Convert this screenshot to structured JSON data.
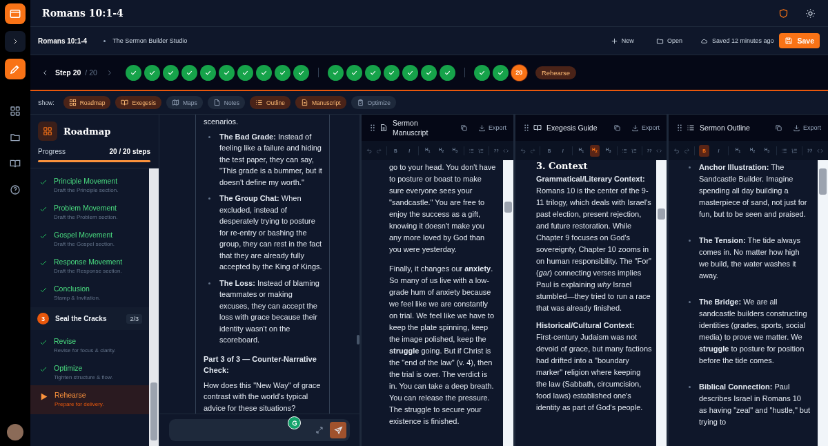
{
  "app": {
    "title": "Romans 10:1-4"
  },
  "header": {
    "title": "Romans 10:1-4",
    "subtitle": "The Sermon Builder Studio",
    "actions": [
      {
        "label": "New"
      },
      {
        "label": "Open"
      }
    ],
    "saved_status": "Saved 12 minutes ago",
    "save_button": "Save"
  },
  "stepper": {
    "label": "Step 20",
    "total": "/ 20",
    "current_name": "Rehearse",
    "groups": [
      {
        "steps": [
          {
            "completed": true
          },
          {
            "completed": true
          },
          {
            "completed": true
          },
          {
            "completed": true
          },
          {
            "completed": true
          },
          {
            "completed": true
          },
          {
            "completed": true
          },
          {
            "completed": true
          },
          {
            "completed": true
          },
          {
            "completed": true
          }
        ]
      },
      {
        "steps": [
          {
            "completed": true
          },
          {
            "completed": true
          },
          {
            "completed": true
          },
          {
            "completed": true
          },
          {
            "completed": true
          },
          {
            "completed": true
          },
          {
            "completed": true
          }
        ]
      },
      {
        "steps": [
          {
            "completed": true
          },
          {
            "completed": true
          },
          {
            "completed": false,
            "label": "20"
          }
        ]
      }
    ]
  },
  "show_bar": {
    "label": "Show:",
    "chips": [
      {
        "label": "Roadmap",
        "selected": true
      },
      {
        "label": "Exegesis",
        "selected": true
      },
      {
        "label": "Maps",
        "selected": false
      },
      {
        "label": "Notes",
        "selected": false
      },
      {
        "label": "Outline",
        "selected": true
      },
      {
        "label": "Manuscript",
        "selected": true
      },
      {
        "label": "Optimize",
        "selected": false
      }
    ]
  },
  "roadmap": {
    "title": "Roadmap",
    "progress_label": "Progress",
    "progress_value": "20 / 20 steps",
    "level": 1,
    "items": [
      {
        "kind": "step",
        "title": "Principle Movement",
        "subtitle": "Draft the Principle section.",
        "completed": true
      },
      {
        "kind": "step",
        "title": "Problem Movement",
        "subtitle": "Draft the Problem section.",
        "completed": true
      },
      {
        "kind": "step",
        "title": "Gospel Movement",
        "subtitle": "Draft the Gospel section.",
        "completed": true
      },
      {
        "kind": "step",
        "title": "Response Movement",
        "subtitle": "Draft the Response section.",
        "completed": true
      },
      {
        "kind": "step",
        "title": "Conclusion",
        "subtitle": "Stamp & Invitation.",
        "completed": true
      },
      {
        "kind": "group",
        "number": "3",
        "title": "Seal the Cracks",
        "count": "2/3"
      },
      {
        "kind": "step",
        "title": "Revise",
        "subtitle": "Revise for focus & clarity.",
        "completed": true
      },
      {
        "kind": "step",
        "title": "Optimize",
        "subtitle": "Tighten structure & flow.",
        "completed": true
      },
      {
        "kind": "step",
        "title": "Rehearse",
        "subtitle": "Prepare for delivery.",
        "completed": false
      }
    ]
  },
  "chat": {
    "blocks": [
      {
        "kind": "p",
        "text": "scenarios."
      },
      {
        "kind": "bullet",
        "text": "**The Bad Grade:** Instead of feeling like a failure and hiding the test paper, they can say, \"This grade is a bummer, but it doesn't define my worth.\""
      },
      {
        "kind": "bullet",
        "text": "**The Group Chat:** When excluded, instead of desperately trying to posture for re-entry or bashing the group, they can rest in the fact that they are already fully accepted by the King of Kings."
      },
      {
        "kind": "bullet",
        "text": "**The Loss:** Instead of blaming teammates or making excuses, they can accept the loss with grace because their identity wasn't on the scoreboard."
      },
      {
        "kind": "heading",
        "text": "Part 3 of 3 — Counter-Narrative Check:"
      },
      {
        "kind": "p",
        "text": "How does this \"New Way\" of grace contrast with the world's typical advice for these situations?"
      }
    ]
  },
  "panels": [
    {
      "title": "Sermon Manuscript",
      "export": "Export",
      "toolbar": [
        {
          "label": "B",
          "selected": false
        },
        {
          "label": "I",
          "selected": false
        },
        {
          "label": "H$_{1}$",
          "selected": false
        },
        {
          "label": "H$_{2}$",
          "selected": false
        },
        {
          "label": "H$_{3}$",
          "selected": false
        }
      ],
      "blocks": [
        {
          "kind": "p",
          "text": "go to your head. You don't have to posture or boast to make sure everyone sees your \"sandcastle.\" You are free to enjoy the success as a gift, knowing it doesn't make you any more loved by God than you were yesterday."
        },
        {
          "kind": "p",
          "text": "Finally, it changes our **anxiety**. So many of us live with a low-grade hum of anxiety because we feel like we are constantly on trial. We feel like we have to keep the plate spinning, keep the image polished, keep the **struggle** going. But if Christ is the \"end of the law\" (v. 4), then the trial is over. The verdict is in. You can take a deep breath. You can release the pressure. The struggle to secure your existence is finished."
        }
      ]
    },
    {
      "title": "Exegesis Guide",
      "export": "Export",
      "toolbar": [
        {
          "label": "B",
          "selected": false
        },
        {
          "label": "I",
          "selected": false
        },
        {
          "label": "H$_{1}$",
          "selected": false
        },
        {
          "label": "H$_{2}$",
          "selected": true
        },
        {
          "label": "H$_{3}$",
          "selected": false
        }
      ],
      "blocks": [
        {
          "kind": "heading",
          "text": "3. Context"
        },
        {
          "kind": "p",
          "text": "**Grammatical/Literary Context:** Romans 10 is the center of the 9-11 trilogy, which deals with Israel's past election, present rejection, and future restoration. While Chapter 9 focuses on God's sovereignty, Chapter 10 zooms in on human responsibility. The \"For\" (*gar*) connecting verses implies Paul is explaining *why* Israel stumbled—they tried to run a race that was already finished."
        },
        {
          "kind": "p",
          "text": "**Historical/Cultural Context:** First-century Judaism was not devoid of grace, but many factions had drifted into a \"boundary marker\" religion where keeping the law (Sabbath, circumcision, food laws) established one's identity as part of God's people."
        }
      ]
    },
    {
      "title": "Sermon Outline",
      "export": "Export",
      "toolbar": [
        {
          "label": "B",
          "selected": true
        },
        {
          "label": "I",
          "selected": false
        },
        {
          "label": "H$_{1}$",
          "selected": false
        },
        {
          "label": "H$_{2}$",
          "selected": false
        },
        {
          "label": "H$_{3}$",
          "selected": false
        }
      ],
      "blocks": [
        {
          "kind": "bullet",
          "text": "**Anchor Illustration:** The Sandcastle Builder. Imagine spending all day building a masterpiece of sand, not just for fun, but to be seen and praised."
        },
        {
          "kind": "bullet",
          "text": "**The Tension:** The tide always comes in. No matter how high we build, the water washes it away."
        },
        {
          "kind": "bullet",
          "text": "**The Bridge:** We are all sandcastle builders constructing identities (grades, sports, social media) to prove we matter. We **struggle** to posture for position before the tide comes."
        },
        {
          "kind": "bullet",
          "text": "**Biblical Connection:** Paul describes Israel in Romans 10 as having \"zeal\" and \"hustle,\" but trying to"
        }
      ]
    }
  ]
}
